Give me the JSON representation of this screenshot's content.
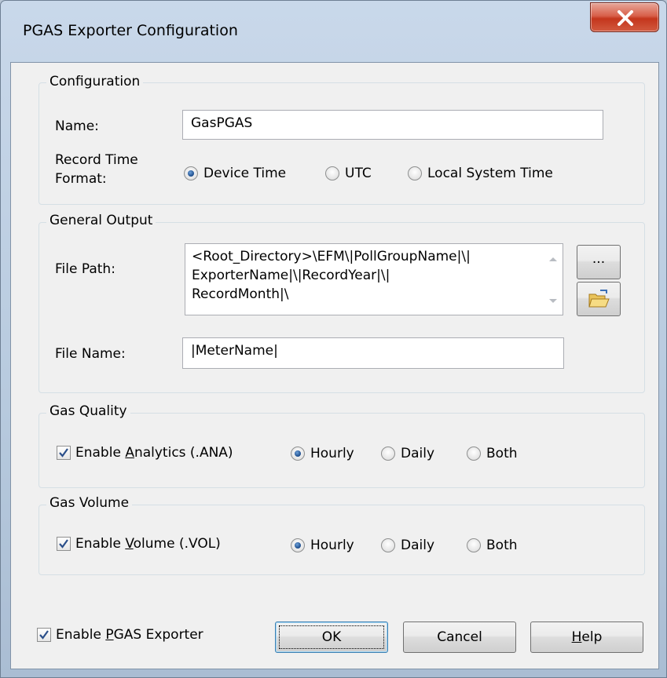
{
  "window": {
    "title": "PGAS Exporter Configuration"
  },
  "configuration": {
    "group_label": "Configuration",
    "name_label": "Name:",
    "name_value": "GasPGAS",
    "record_time_label_line1": "Record Time",
    "record_time_label_line2": "Format:",
    "time_options": [
      {
        "label": "Device Time",
        "checked": true
      },
      {
        "label": "UTC",
        "checked": false
      },
      {
        "label": "Local System Time",
        "checked": false
      }
    ]
  },
  "general_output": {
    "group_label": "General Output",
    "file_path_label": "File Path:",
    "file_path_lines": [
      "<Root_Directory>\\EFM\\|PollGroupName|\\|",
      "ExporterName|\\|RecordYear|\\|",
      "RecordMonth|\\"
    ],
    "browse_label": "...",
    "file_name_label": "File Name:",
    "file_name_value": "|MeterName|"
  },
  "gas_quality": {
    "group_label": "Gas Quality",
    "enable_label_pre": "Enable ",
    "enable_label_accel": "A",
    "enable_label_post": "nalytics (.ANA)",
    "enabled": true,
    "options": [
      {
        "label": "Hourly",
        "checked": true
      },
      {
        "label": "Daily",
        "checked": false
      },
      {
        "label": "Both",
        "checked": false
      }
    ]
  },
  "gas_volume": {
    "group_label": "Gas Volume",
    "enable_label_pre": "Enable ",
    "enable_label_accel": "V",
    "enable_label_post": "olume (.VOL)",
    "enabled": true,
    "options": [
      {
        "label": "Hourly",
        "checked": true
      },
      {
        "label": "Daily",
        "checked": false
      },
      {
        "label": "Both",
        "checked": false
      }
    ]
  },
  "footer": {
    "enable_pgas_pre": "Enable ",
    "enable_pgas_accel": "P",
    "enable_pgas_post": "GAS Exporter",
    "enable_pgas_checked": true,
    "ok_label": "OK",
    "cancel_label": "Cancel",
    "help_accel": "H",
    "help_post": "elp"
  },
  "colors": {
    "close_button": "#c4361d",
    "radio_selected": "#1a4a8a"
  }
}
